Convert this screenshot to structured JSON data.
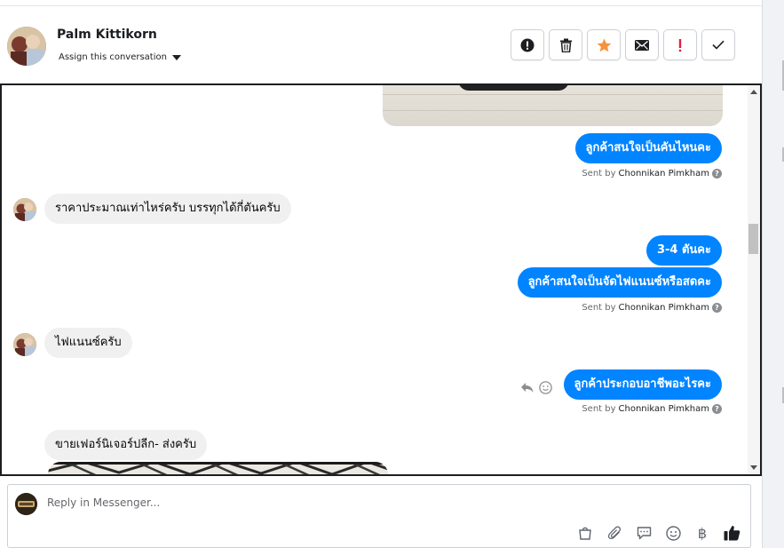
{
  "header": {
    "contact_name": "Palm Kittikorn",
    "assign_label": "Assign this conversation",
    "actions": [
      {
        "name": "mark-spam-button",
        "icon": "alert-circle-icon"
      },
      {
        "name": "delete-button",
        "icon": "trash-icon"
      },
      {
        "name": "star-button",
        "icon": "star-icon"
      },
      {
        "name": "mark-unread-button",
        "icon": "envelope-icon"
      },
      {
        "name": "important-button",
        "icon": "exclamation-icon"
      },
      {
        "name": "mark-done-button",
        "icon": "check-icon"
      }
    ]
  },
  "thread": {
    "messages": [
      {
        "direction": "out",
        "text": "ลูกค้าสนใจเป็นคันไหนคะ"
      },
      {
        "direction": "in",
        "text": "ราคาประมาณเท่าไหร่ครับ บรรทุกได้กี่ตันครับ"
      },
      {
        "direction": "out",
        "text": "3-4 ตันคะ"
      },
      {
        "direction": "out",
        "text": "ลูกค้าสนใจเป็นจัดไฟแนนซ์หรือสดคะ"
      },
      {
        "direction": "in",
        "text": "ไฟแนนซ์ครับ"
      },
      {
        "direction": "out",
        "text": "ลูกค้าประกอบอาชีพอะไรคะ"
      },
      {
        "direction": "in",
        "text": "ขายเฟอร์นิเจอร์ปลีก- ส่งครับ"
      }
    ],
    "sent_by_prefix": "Sent by",
    "sent_by_name": "Chonnikan Pimkham",
    "help_mark": "?"
  },
  "composer": {
    "placeholder": "Reply in Messenger...",
    "tools": [
      "shopping-bag-icon",
      "paperclip-icon",
      "saved-reply-icon",
      "emoji-icon",
      "baht-icon",
      "thumbs-up-icon"
    ],
    "baht_symbol": "฿"
  },
  "colors": {
    "outgoing_bubble": "#0084ff",
    "incoming_bubble": "#f0f0f0",
    "star": "#f7923b",
    "important": "#e41e3f"
  }
}
